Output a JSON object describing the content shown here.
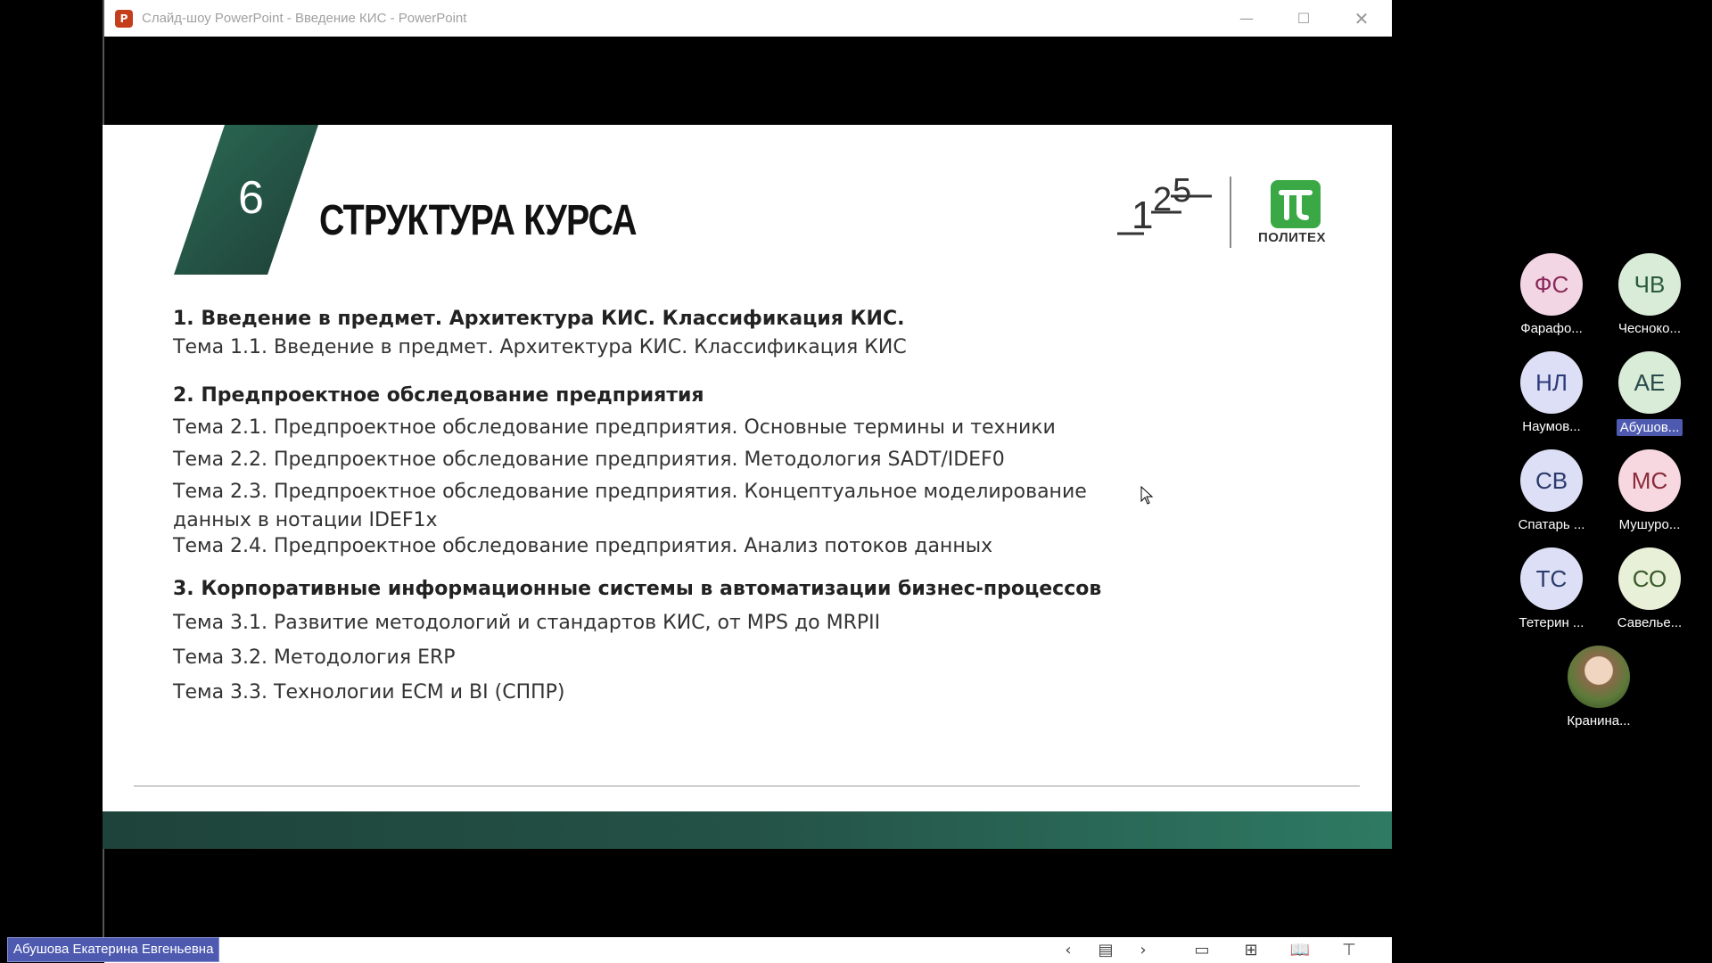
{
  "window": {
    "app_icon": "P",
    "title": "Слайд-шоу PowerPoint  -  Введение КИС - PowerPoint",
    "minimize": "—",
    "maximize": "☐",
    "close": "✕"
  },
  "slide": {
    "number": "6",
    "title": "СТРУКТУРА КУРСА",
    "logo_text": "ПОЛИТЕХ",
    "sections": [
      {
        "heading": "1. Введение в предмет. Архитектура КИС. Классификация КИС.",
        "topics": [
          "Тема 1.1. Введение в предмет. Архитектура КИС. Классификация КИС"
        ]
      },
      {
        "heading": "2. Предпроектное обследование предприятия",
        "topics": [
          "Тема 2.1. Предпроектное обследование предприятия. Основные термины и техники",
          "Тема 2.2. Предпроектное обследование предприятия. Методология SADT/IDEF0",
          "Тема 2.3. Предпроектное обследование предприятия. Концептуальное моделирование",
          "данных в нотации IDEF1x",
          "Тема 2.4. Предпроектное обследование предприятия. Анализ потоков данных"
        ]
      },
      {
        "heading": "3. Корпоративные информационные системы в автоматизации бизнес-процессов",
        "topics": [
          "Тема 3.1. Развитие методологий и стандартов КИС, от MPS до MRPII",
          "Тема 3.2. Методология ERP",
          "Тема 3.3. Технологии ECM и BI (СППР)"
        ]
      }
    ]
  },
  "statusbar": {
    "prev": "‹",
    "slides": "▤",
    "next": "›",
    "normal_view": "▭",
    "sorter_view": "⊞",
    "reading_view": "📖",
    "slideshow_view": "⊤"
  },
  "presenter": "Абушова Екатерина Евгеньевна",
  "participants": [
    {
      "initials": "ФС",
      "name": "Фарафо...",
      "color": "#f3d6e4",
      "text": "#8a2a5a"
    },
    {
      "initials": "ЧВ",
      "name": "Чесноко...",
      "color": "#d8ecd8",
      "text": "#2a5a3a"
    },
    {
      "initials": "НЛ",
      "name": "Наумов...",
      "color": "#dcdff5",
      "text": "#2a3a7a"
    },
    {
      "initials": "АЕ",
      "name": "Абушов...",
      "color": "#d8ecd8",
      "text": "#2a4a4a"
    },
    {
      "initials": "СВ",
      "name": "Спатарь ...",
      "color": "#dcdff5",
      "text": "#2a3a6a"
    },
    {
      "initials": "МС",
      "name": "Мушуро...",
      "color": "#f8d8e0",
      "text": "#8a2a3a"
    },
    {
      "initials": "ТС",
      "name": "Тетерин ...",
      "color": "#dcdff5",
      "text": "#2a3a6a"
    },
    {
      "initials": "СО",
      "name": "Савелье...",
      "color": "#e8f0d8",
      "text": "#3a5a2a"
    }
  ],
  "photo_participant": {
    "name": "Кранина..."
  }
}
